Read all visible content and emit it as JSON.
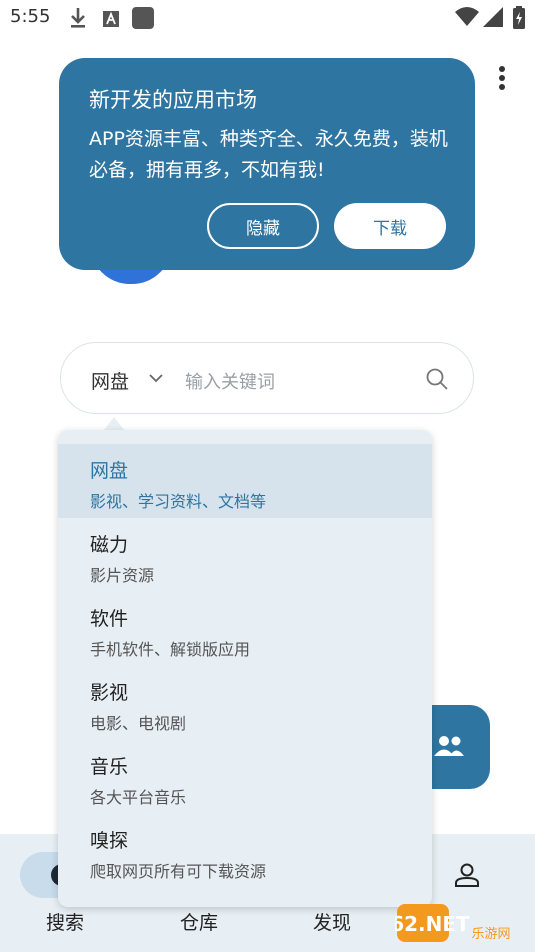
{
  "status_bar": {
    "time": "5:55",
    "icons": [
      "download-icon",
      "text-icon",
      "app-square-icon",
      "wifi-icon",
      "signal-icon",
      "battery-icon"
    ]
  },
  "promo": {
    "title": "新开发的应用市场",
    "description": "APP资源丰富、种类齐全、永久免费，装机必备，拥有再多，不如有我!",
    "hide_label": "隐藏",
    "download_label": "下载"
  },
  "search": {
    "type_label": "网盘",
    "placeholder": "输入关键词"
  },
  "dropdown": {
    "items": [
      {
        "title": "网盘",
        "subtitle": "影视、学习资料、文档等",
        "selected": true
      },
      {
        "title": "磁力",
        "subtitle": "影片资源",
        "selected": false
      },
      {
        "title": "软件",
        "subtitle": "手机软件、解锁版应用",
        "selected": false
      },
      {
        "title": "影视",
        "subtitle": "电影、电视剧",
        "selected": false
      },
      {
        "title": "音乐",
        "subtitle": "各大平台音乐",
        "selected": false
      },
      {
        "title": "嗅探",
        "subtitle": "爬取网页所有可下载资源",
        "selected": false
      }
    ]
  },
  "bottom_nav": {
    "items": [
      {
        "label": "搜索",
        "icon": "search-nav-icon",
        "active": true
      },
      {
        "label": "仓库",
        "icon": "warehouse-icon",
        "active": false
      },
      {
        "label": "发现",
        "icon": "discover-icon",
        "active": false
      },
      {
        "label": "",
        "icon": "profile-icon",
        "active": false
      }
    ]
  },
  "watermark": {
    "text": "962.NET",
    "subtext": "乐游网"
  },
  "colors": {
    "accent": "#2e75a1",
    "menu_bg": "#e8eff4",
    "selected_bg": "#d6e3ec"
  }
}
